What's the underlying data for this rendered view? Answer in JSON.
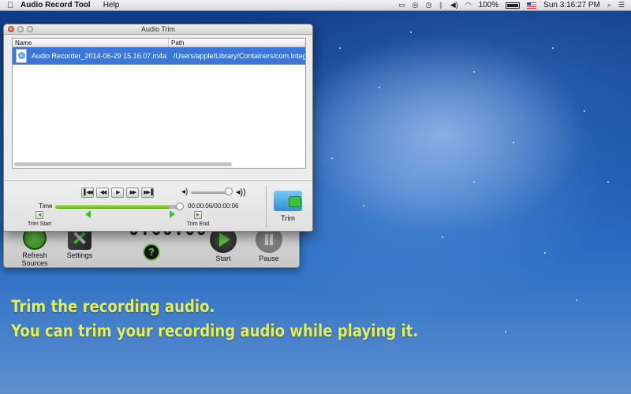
{
  "menubar": {
    "apple_icon": "apple-logo-icon",
    "app_name": "Audio Record Tool",
    "menus": [
      "Help"
    ],
    "battery_percent": "100%",
    "clock": "Sun 3:16:27 PM"
  },
  "main_window": {
    "time_display": "0:00:00",
    "refresh_label": "Refresh Sources",
    "settings_label": "Settings",
    "start_label": "Start",
    "pause_label": "Pause",
    "help_glyph": "?"
  },
  "trim_window": {
    "title": "Audio Trim",
    "columns": {
      "name": "Name",
      "path": "Path"
    },
    "files": [
      {
        "name": "Audio Recorder_2014-06-29 15.16.07.m4a",
        "path": "/Users/apple/Library/Containers/com.Integ"
      }
    ],
    "time_label": "Time",
    "time_readout": "00:00:06/00:00:06",
    "playback_progress": 0.92,
    "volume_level": 0.85,
    "trim_start_caption": "Trim Start",
    "trim_end_caption": "Trim End",
    "trim_button_label": "Trim"
  },
  "caption": {
    "line1": "Trim the recording audio.",
    "line2": "You can trim your recording audio while playing it."
  },
  "colors": {
    "selection": "#3a77d7",
    "accent_green": "#3cbf3c",
    "caption_text": "#e2ef5a"
  }
}
